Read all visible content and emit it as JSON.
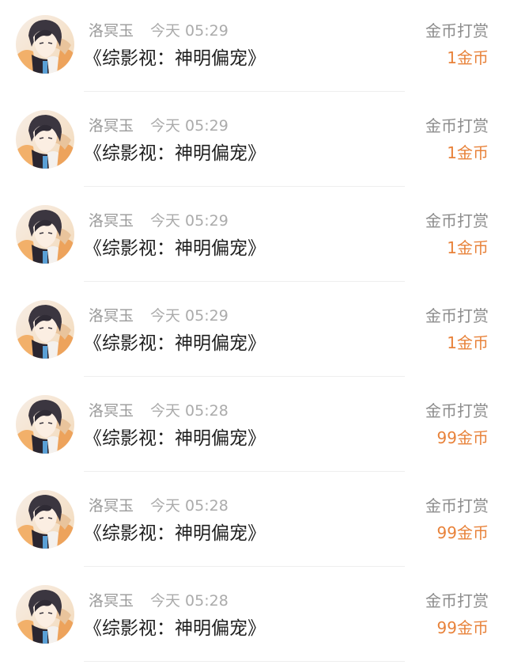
{
  "colors": {
    "muted_text": "#9a9a9a",
    "title_text": "#1e1e1e",
    "accent_orange": "#e8823a",
    "divider": "#eeeeee"
  },
  "records": [
    {
      "user": "洛冥玉",
      "time": "今天 05:29",
      "title": "《综影视：神明偏宠》",
      "reward_type": "金币打赏",
      "amount": "1金币",
      "avatar_icon": "anime-avatar-icon"
    },
    {
      "user": "洛冥玉",
      "time": "今天 05:29",
      "title": "《综影视：神明偏宠》",
      "reward_type": "金币打赏",
      "amount": "1金币",
      "avatar_icon": "anime-avatar-icon"
    },
    {
      "user": "洛冥玉",
      "time": "今天 05:29",
      "title": "《综影视：神明偏宠》",
      "reward_type": "金币打赏",
      "amount": "1金币",
      "avatar_icon": "anime-avatar-icon"
    },
    {
      "user": "洛冥玉",
      "time": "今天 05:29",
      "title": "《综影视：神明偏宠》",
      "reward_type": "金币打赏",
      "amount": "1金币",
      "avatar_icon": "anime-avatar-icon"
    },
    {
      "user": "洛冥玉",
      "time": "今天 05:28",
      "title": "《综影视：神明偏宠》",
      "reward_type": "金币打赏",
      "amount": "99金币",
      "avatar_icon": "anime-avatar-icon"
    },
    {
      "user": "洛冥玉",
      "time": "今天 05:28",
      "title": "《综影视：神明偏宠》",
      "reward_type": "金币打赏",
      "amount": "99金币",
      "avatar_icon": "anime-avatar-icon"
    },
    {
      "user": "洛冥玉",
      "time": "今天 05:28",
      "title": "《综影视：神明偏宠》",
      "reward_type": "金币打赏",
      "amount": "99金币",
      "avatar_icon": "anime-avatar-icon"
    }
  ]
}
